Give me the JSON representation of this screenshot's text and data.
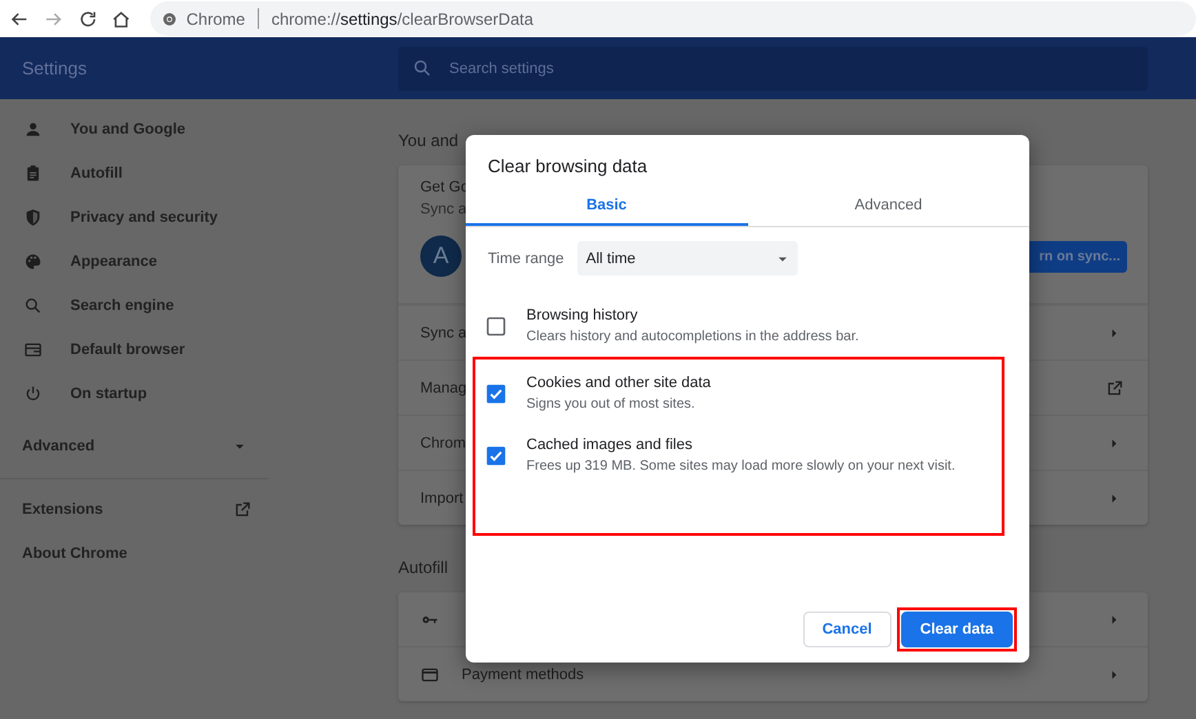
{
  "browser": {
    "site_label": "Chrome",
    "url_prefix": "chrome://",
    "url_bold": "settings",
    "url_rest": "/clearBrowserData"
  },
  "header": {
    "title": "Settings",
    "search_placeholder": "Search settings"
  },
  "sidebar": {
    "items": [
      {
        "label": "You and Google"
      },
      {
        "label": "Autofill"
      },
      {
        "label": "Privacy and security"
      },
      {
        "label": "Appearance"
      },
      {
        "label": "Search engine"
      },
      {
        "label": "Default browser"
      },
      {
        "label": "On startup"
      }
    ],
    "advanced": {
      "label": "Advanced",
      "expanded": false
    },
    "links": [
      {
        "label": "Extensions"
      },
      {
        "label": "About Chrome"
      }
    ]
  },
  "content": {
    "section_1": {
      "heading": "You and",
      "card_title": "Get Go",
      "card_sub": "Sync a",
      "avatar": "A",
      "sync_button": "rn on sync...",
      "rows": [
        {
          "label": "Sync a",
          "kind": "submenu"
        },
        {
          "label": "Manag",
          "kind": "external"
        },
        {
          "label": "Chrom",
          "kind": "submenu"
        },
        {
          "label": "Import",
          "kind": "submenu"
        }
      ]
    },
    "section_2": {
      "heading": "Autofill",
      "rows": [
        {
          "kind": "submenu"
        },
        {
          "label": "Payment methods",
          "kind": "submenu"
        }
      ]
    }
  },
  "dialog": {
    "title": "Clear browsing data",
    "tabs": [
      {
        "label": "Basic",
        "selected": true
      },
      {
        "label": "Advanced",
        "selected": false
      }
    ],
    "time_range": {
      "label": "Time range",
      "value": "All time"
    },
    "options": [
      {
        "title": "Browsing history",
        "description": "Clears history and autocompletions in the address bar.",
        "checked": false,
        "highlighted": false
      },
      {
        "title": "Cookies and other site data",
        "description": "Signs you out of most sites.",
        "checked": true,
        "highlighted": true
      },
      {
        "title": "Cached images and files",
        "description": "Frees up 319 MB. Some sites may load more slowly on your next visit.",
        "checked": true,
        "highlighted": true
      }
    ],
    "buttons": [
      {
        "label": "Cancel",
        "kind": "secondary",
        "highlighted": false
      },
      {
        "label": "Clear data",
        "kind": "primary",
        "highlighted": true
      }
    ]
  }
}
